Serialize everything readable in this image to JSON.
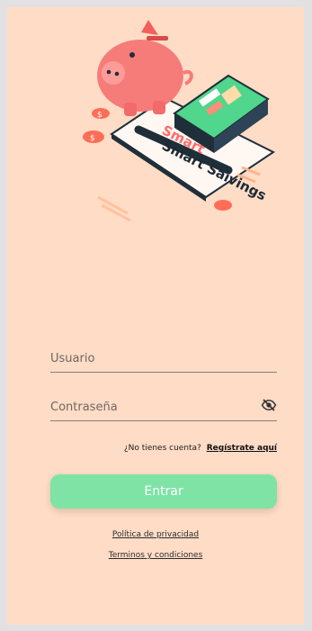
{
  "hero": {
    "logo_text": "Smart Saivings",
    "icon": "piggy-bank-icon"
  },
  "form": {
    "username_placeholder": "Usuario",
    "password_placeholder": "Contraseña",
    "password_toggle_icon": "eye-off-icon"
  },
  "register": {
    "question": "¿No tienes cuenta?",
    "link": "Regístrate aquí"
  },
  "actions": {
    "submit_label": "Entrar"
  },
  "legal": {
    "privacy": "Política de privacidad",
    "terms": "Terminos y condiciones"
  },
  "theme": {
    "background": "#ffdcc6",
    "accent": "#7fe3a5"
  }
}
